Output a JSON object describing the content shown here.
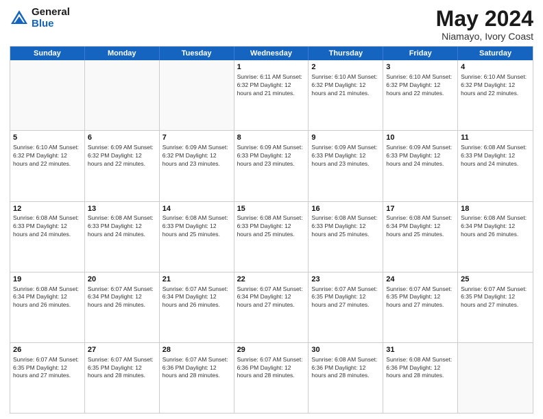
{
  "header": {
    "logo_general": "General",
    "logo_blue": "Blue",
    "title": "May 2024",
    "location": "Niamayo, Ivory Coast"
  },
  "weekdays": [
    "Sunday",
    "Monday",
    "Tuesday",
    "Wednesday",
    "Thursday",
    "Friday",
    "Saturday"
  ],
  "rows": [
    [
      {
        "day": "",
        "info": "",
        "empty": true
      },
      {
        "day": "",
        "info": "",
        "empty": true
      },
      {
        "day": "",
        "info": "",
        "empty": true
      },
      {
        "day": "1",
        "info": "Sunrise: 6:11 AM\nSunset: 6:32 PM\nDaylight: 12 hours\nand 21 minutes."
      },
      {
        "day": "2",
        "info": "Sunrise: 6:10 AM\nSunset: 6:32 PM\nDaylight: 12 hours\nand 21 minutes."
      },
      {
        "day": "3",
        "info": "Sunrise: 6:10 AM\nSunset: 6:32 PM\nDaylight: 12 hours\nand 22 minutes."
      },
      {
        "day": "4",
        "info": "Sunrise: 6:10 AM\nSunset: 6:32 PM\nDaylight: 12 hours\nand 22 minutes."
      }
    ],
    [
      {
        "day": "5",
        "info": "Sunrise: 6:10 AM\nSunset: 6:32 PM\nDaylight: 12 hours\nand 22 minutes."
      },
      {
        "day": "6",
        "info": "Sunrise: 6:09 AM\nSunset: 6:32 PM\nDaylight: 12 hours\nand 22 minutes."
      },
      {
        "day": "7",
        "info": "Sunrise: 6:09 AM\nSunset: 6:32 PM\nDaylight: 12 hours\nand 23 minutes."
      },
      {
        "day": "8",
        "info": "Sunrise: 6:09 AM\nSunset: 6:33 PM\nDaylight: 12 hours\nand 23 minutes."
      },
      {
        "day": "9",
        "info": "Sunrise: 6:09 AM\nSunset: 6:33 PM\nDaylight: 12 hours\nand 23 minutes."
      },
      {
        "day": "10",
        "info": "Sunrise: 6:09 AM\nSunset: 6:33 PM\nDaylight: 12 hours\nand 24 minutes."
      },
      {
        "day": "11",
        "info": "Sunrise: 6:08 AM\nSunset: 6:33 PM\nDaylight: 12 hours\nand 24 minutes."
      }
    ],
    [
      {
        "day": "12",
        "info": "Sunrise: 6:08 AM\nSunset: 6:33 PM\nDaylight: 12 hours\nand 24 minutes."
      },
      {
        "day": "13",
        "info": "Sunrise: 6:08 AM\nSunset: 6:33 PM\nDaylight: 12 hours\nand 24 minutes."
      },
      {
        "day": "14",
        "info": "Sunrise: 6:08 AM\nSunset: 6:33 PM\nDaylight: 12 hours\nand 25 minutes."
      },
      {
        "day": "15",
        "info": "Sunrise: 6:08 AM\nSunset: 6:33 PM\nDaylight: 12 hours\nand 25 minutes."
      },
      {
        "day": "16",
        "info": "Sunrise: 6:08 AM\nSunset: 6:33 PM\nDaylight: 12 hours\nand 25 minutes."
      },
      {
        "day": "17",
        "info": "Sunrise: 6:08 AM\nSunset: 6:34 PM\nDaylight: 12 hours\nand 25 minutes."
      },
      {
        "day": "18",
        "info": "Sunrise: 6:08 AM\nSunset: 6:34 PM\nDaylight: 12 hours\nand 26 minutes."
      }
    ],
    [
      {
        "day": "19",
        "info": "Sunrise: 6:08 AM\nSunset: 6:34 PM\nDaylight: 12 hours\nand 26 minutes."
      },
      {
        "day": "20",
        "info": "Sunrise: 6:07 AM\nSunset: 6:34 PM\nDaylight: 12 hours\nand 26 minutes."
      },
      {
        "day": "21",
        "info": "Sunrise: 6:07 AM\nSunset: 6:34 PM\nDaylight: 12 hours\nand 26 minutes."
      },
      {
        "day": "22",
        "info": "Sunrise: 6:07 AM\nSunset: 6:34 PM\nDaylight: 12 hours\nand 27 minutes."
      },
      {
        "day": "23",
        "info": "Sunrise: 6:07 AM\nSunset: 6:35 PM\nDaylight: 12 hours\nand 27 minutes."
      },
      {
        "day": "24",
        "info": "Sunrise: 6:07 AM\nSunset: 6:35 PM\nDaylight: 12 hours\nand 27 minutes."
      },
      {
        "day": "25",
        "info": "Sunrise: 6:07 AM\nSunset: 6:35 PM\nDaylight: 12 hours\nand 27 minutes."
      }
    ],
    [
      {
        "day": "26",
        "info": "Sunrise: 6:07 AM\nSunset: 6:35 PM\nDaylight: 12 hours\nand 27 minutes."
      },
      {
        "day": "27",
        "info": "Sunrise: 6:07 AM\nSunset: 6:35 PM\nDaylight: 12 hours\nand 28 minutes."
      },
      {
        "day": "28",
        "info": "Sunrise: 6:07 AM\nSunset: 6:36 PM\nDaylight: 12 hours\nand 28 minutes."
      },
      {
        "day": "29",
        "info": "Sunrise: 6:07 AM\nSunset: 6:36 PM\nDaylight: 12 hours\nand 28 minutes."
      },
      {
        "day": "30",
        "info": "Sunrise: 6:08 AM\nSunset: 6:36 PM\nDaylight: 12 hours\nand 28 minutes."
      },
      {
        "day": "31",
        "info": "Sunrise: 6:08 AM\nSunset: 6:36 PM\nDaylight: 12 hours\nand 28 minutes."
      },
      {
        "day": "",
        "info": "",
        "empty": true
      }
    ]
  ]
}
